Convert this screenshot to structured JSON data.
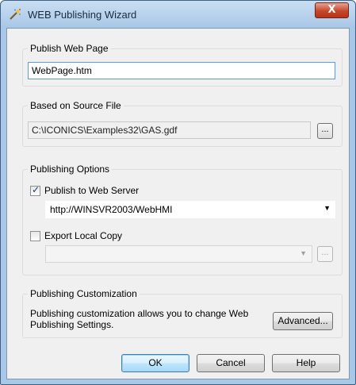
{
  "window": {
    "title": "WEB Publishing Wizard",
    "close_label": "X"
  },
  "publish_web_page": {
    "group_label": "Publish Web Page",
    "value": "WebPage.htm"
  },
  "source_file": {
    "group_label": "Based on Source File",
    "value": "C:\\ICONICS\\Examples32\\GAS.gdf",
    "browse_label": "..."
  },
  "publishing_options": {
    "group_label": "Publishing Options",
    "publish_to_server": {
      "label": "Publish to Web Server",
      "checked": true
    },
    "server_url": "http://WINSVR2003/WebHMI",
    "export_local_copy": {
      "label": "Export Local Copy",
      "checked": false
    },
    "local_path": "",
    "browse_label": "..."
  },
  "customization": {
    "group_label": "Publishing Customization",
    "description_line1": "Publishing customization allows you  to change Web",
    "description_line2": "Publishing Settings.",
    "advanced_label": "Advanced..."
  },
  "buttons": {
    "ok": "OK",
    "cancel": "Cancel",
    "help": "Help"
  }
}
